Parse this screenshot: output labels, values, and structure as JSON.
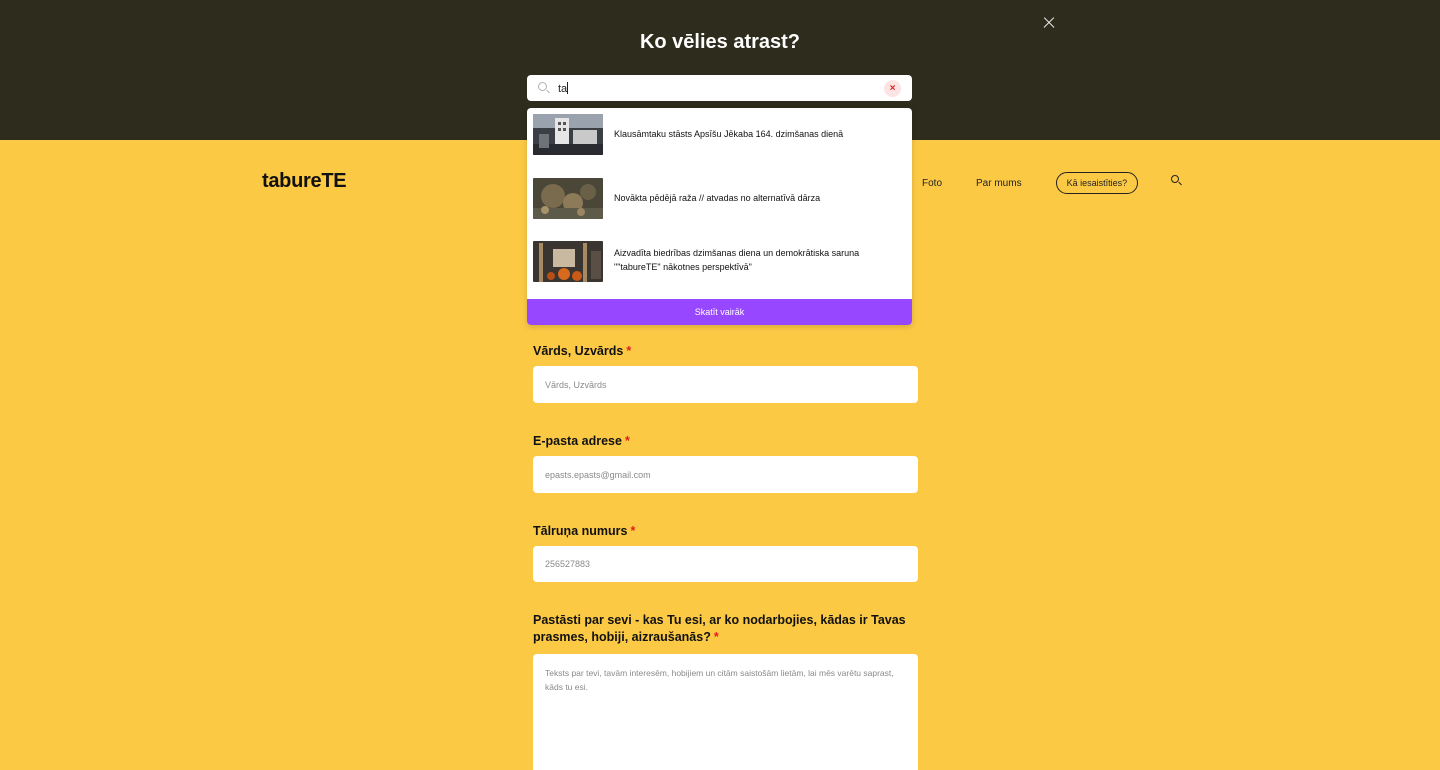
{
  "site": {
    "logo": "tabureTE",
    "nav": {
      "links": [
        "Foto",
        "Par mums"
      ],
      "cta": "Kā iesaistīties?"
    }
  },
  "form": {
    "name": {
      "label": "Vārds, Uzvārds",
      "required_mark": "*",
      "placeholder": "Vārds, Uzvārds"
    },
    "email": {
      "label": "E-pasta adrese",
      "required_mark": "*",
      "placeholder": "epasts.epasts@gmail.com"
    },
    "phone": {
      "label": "Tālruņa numurs",
      "required_mark": "*",
      "placeholder": "256527883"
    },
    "about": {
      "label": "Pastāsti par sevi - kas Tu esi, ar ko nodarbojies, kādas ir Tavas prasmes, hobiji, aizraušanās?",
      "required_mark": "*",
      "placeholder": "Teksts par tevi, tavām interesēm, hobijiem un citām saistošām lietām, lai mēs varētu saprast, kāds tu esi."
    }
  },
  "search_overlay": {
    "title": "Ko vēlies atrast?",
    "query": "ta",
    "clear_icon": "×",
    "results": [
      {
        "title": "Klausāmtaku stāsts Apsīšu Jēkaba 164. dzimšanas dienā"
      },
      {
        "title": "Novākta pēdējā raža // atvadas no alternatīvā dārza"
      },
      {
        "title": "Aizvadīta biedrības dzimšanas diena un demokrātiska saruna \"\"tabureTE\" nākotnes perspektīvā\""
      }
    ],
    "see_more": "Skatīt vairāk"
  },
  "colors": {
    "page_bg": "#fcc945",
    "overlay_bg": "#2e2c1c",
    "accent": "#9747ff",
    "required": "#e0201b"
  }
}
